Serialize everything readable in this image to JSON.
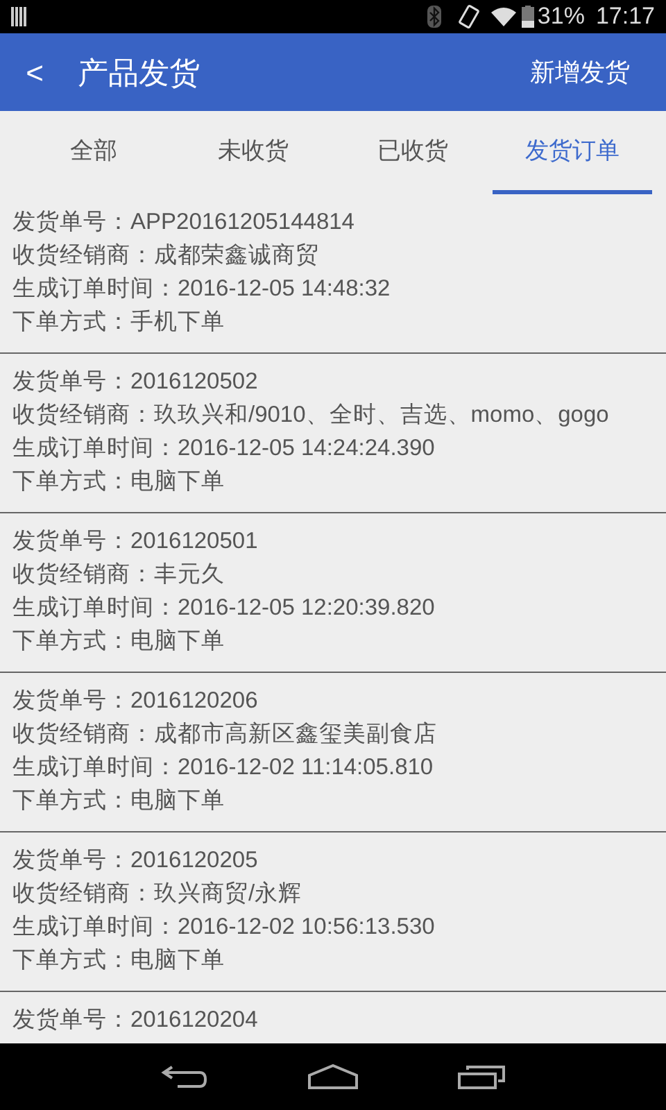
{
  "status_bar": {
    "battery": "31%",
    "time": "17:17"
  },
  "app_bar": {
    "back": "<",
    "title": "产品发货",
    "action": "新增发货"
  },
  "tabs": [
    {
      "label": "全部",
      "selected": false
    },
    {
      "label": "未收货",
      "selected": false
    },
    {
      "label": "已收货",
      "selected": false
    },
    {
      "label": "发货订单",
      "selected": true
    }
  ],
  "orders": [
    {
      "lines": [
        "发货单号：APP20161205144814",
        "收货经销商：成都荣鑫诚商贸",
        "生成订单时间：2016-12-05 14:48:32",
        "下单方式：手机下单"
      ]
    },
    {
      "lines": [
        "发货单号：2016120502",
        "收货经销商：玖玖兴和/9010、全时、吉选、momo、gogo",
        "生成订单时间：2016-12-05 14:24:24.390",
        "下单方式：电脑下单"
      ]
    },
    {
      "lines": [
        "发货单号：2016120501",
        "收货经销商：丰元久",
        "生成订单时间：2016-12-05 12:20:39.820",
        "下单方式：电脑下单"
      ]
    },
    {
      "lines": [
        "发货单号：2016120206",
        "收货经销商：成都市高新区鑫玺美副食店",
        "生成订单时间：2016-12-02 11:14:05.810",
        "下单方式：电脑下单"
      ]
    },
    {
      "lines": [
        "发货单号：2016120205",
        "收货经销商：玖兴商贸/永辉",
        "生成订单时间：2016-12-02 10:56:13.530",
        "下单方式：电脑下单"
      ]
    },
    {
      "lines": [
        "发货单号：2016120204"
      ]
    }
  ]
}
